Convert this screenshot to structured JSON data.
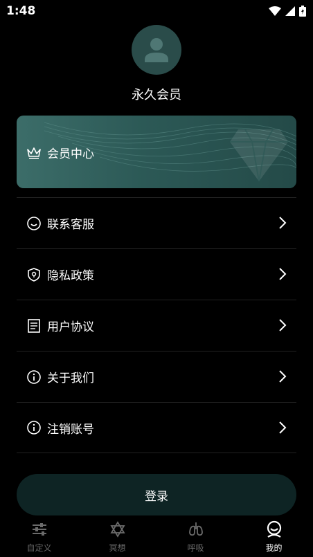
{
  "status_bar": {
    "time": "1:48"
  },
  "profile": {
    "username": "永久会员"
  },
  "vip": {
    "label": "会员中心"
  },
  "menu": [
    {
      "label": "联系客服",
      "icon": "smile-icon"
    },
    {
      "label": "隐私政策",
      "icon": "shield-icon"
    },
    {
      "label": "用户协议",
      "icon": "document-icon"
    },
    {
      "label": "关于我们",
      "icon": "info-icon"
    },
    {
      "label": "注销账号",
      "icon": "info-icon"
    }
  ],
  "login": {
    "label": "登录"
  },
  "tabs": [
    {
      "label": "自定义",
      "icon": "sliders-icon",
      "active": false
    },
    {
      "label": "冥想",
      "icon": "star-of-david-icon",
      "active": false
    },
    {
      "label": "呼吸",
      "icon": "lungs-icon",
      "active": false
    },
    {
      "label": "我的",
      "icon": "profile-icon",
      "active": true
    }
  ],
  "colors": {
    "background": "#000000",
    "card": "#2c5956",
    "button": "#0e2424",
    "inactive": "#6b6b6b"
  }
}
